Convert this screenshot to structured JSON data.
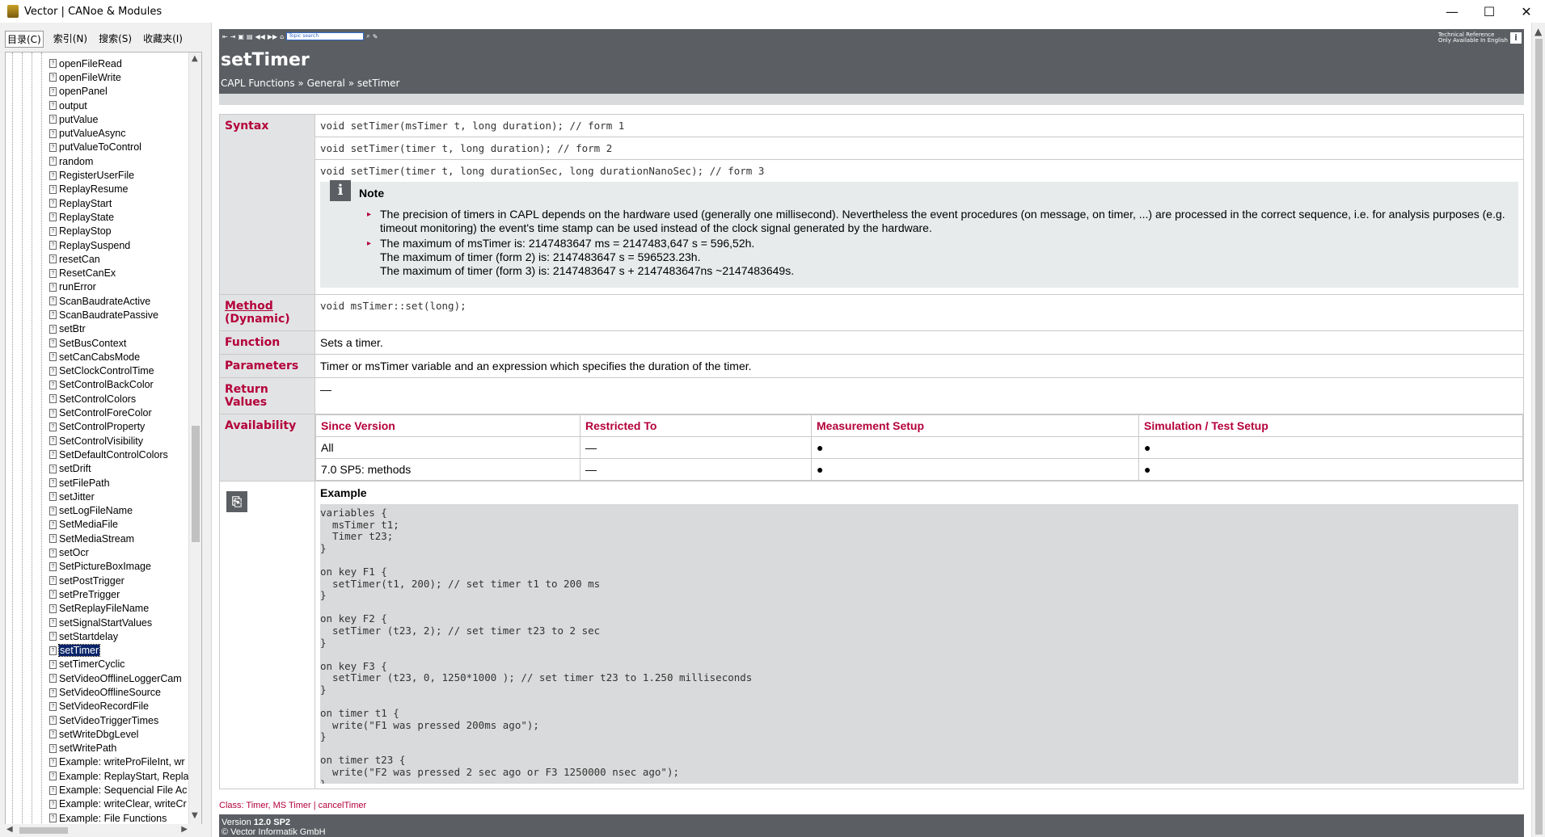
{
  "window": {
    "title": "Vector | CANoe & Modules",
    "minimize": "—",
    "maximize": "☐",
    "close": "✕"
  },
  "left_tabs": [
    "目录(C)",
    "索引(N)",
    "搜索(S)",
    "收藏夹(I)"
  ],
  "tree": {
    "items": [
      "openFileRead",
      "openFileWrite",
      "openPanel",
      "output",
      "putValue",
      "putValueAsync",
      "putValueToControl",
      "random",
      "RegisterUserFile",
      "ReplayResume",
      "ReplayStart",
      "ReplayState",
      "ReplayStop",
      "ReplaySuspend",
      "resetCan",
      "ResetCanEx",
      "runError",
      "ScanBaudrateActive",
      "ScanBaudratePassive",
      "setBtr",
      "SetBusContext",
      "setCanCabsMode",
      "SetClockControlTime",
      "SetControlBackColor",
      "SetControlColors",
      "SetControlForeColor",
      "SetControlProperty",
      "SetControlVisibility",
      "SetDefaultControlColors",
      "setDrift",
      "setFilePath",
      "setJitter",
      "setLogFileName",
      "SetMediaFile",
      "SetMediaStream",
      "setOcr",
      "SetPictureBoxImage",
      "setPostTrigger",
      "setPreTrigger",
      "SetReplayFileName",
      "setSignalStartValues",
      "setStartdelay",
      "setTimer",
      "setTimerCyclic",
      "SetVideoOfflineLoggerCam",
      "SetVideoOfflineSource",
      "SetVideoRecordFile",
      "SetVideoTriggerTimes",
      "setWriteDbgLevel",
      "setWritePath",
      "Example: writeProFileInt, wr",
      "Example: ReplayStart, Repla",
      "Example: Sequencial File Ac",
      "Example: writeClear, writeCr",
      "Example: File Functions"
    ],
    "selected": "setTimer"
  },
  "toolbar": {
    "search_placeholder": "Topic search",
    "tech_ref_line1": "Technical Reference",
    "tech_ref_line2": "Only Available In English",
    "info": "i"
  },
  "topic": {
    "title": "setTimer",
    "breadcrumb": "CAPL Functions » General » setTimer"
  },
  "syntax": {
    "label": "Syntax",
    "form1": "void setTimer(msTimer t, long duration); // form 1",
    "form2": "void setTimer(timer t, long duration); // form 2",
    "form3": "void setTimer(timer t, long durationSec, long durationNanoSec); // form 3"
  },
  "note": {
    "icon": "i",
    "title": "Note",
    "item1": "The precision of timers in CAPL depends on the hardware used (generally one millisecond). Nevertheless the event procedures (on message, on timer, ...) are processed in the correct sequence, i.e. for analysis purposes (e.g. timeout monitoring) the event's time stamp can be used instead of the clock signal generated by the hardware.",
    "item2_l1": "The maximum of msTimer is: 2147483647 ms = 2147483,647 s = 596,52h.",
    "item2_l2": "The maximum of timer (form 2) is: 2147483647 s = 596523.23h.",
    "item2_l3": "The maximum of timer (form 3) is: 2147483647 s + 2147483647ns ~2147483649s."
  },
  "method": {
    "label1": "Method",
    "label2": "(Dynamic)",
    "code": "void msTimer::set(long);"
  },
  "function": {
    "label": "Function",
    "value": "Sets a timer."
  },
  "parameters": {
    "label": "Parameters",
    "value": "Timer or msTimer variable and an expression which specifies the duration of the timer."
  },
  "return_values": {
    "label": "Return Values",
    "value": "—"
  },
  "availability": {
    "label": "Availability",
    "headers": [
      "Since Version",
      "Restricted To",
      "Measurement Setup",
      "Simulation / Test Setup"
    ],
    "rows": [
      [
        "All",
        "—",
        "●",
        "●"
      ],
      [
        "7.0 SP5: methods",
        "—",
        "●",
        "●"
      ]
    ]
  },
  "example": {
    "title": "Example",
    "code": "variables {\n  msTimer t1;\n  Timer t23;\n}\n\non key F1 {\n  setTimer(t1, 200); // set timer t1 to 200 ms\n}\n\non key F2 {\n  setTimer (t23, 2); // set timer t23 to 2 sec\n}\n\non key F3 {\n  setTimer (t23, 0, 1250*1000 ); // set timer t23 to 1.250 milliseconds\n}\n\non timer t1 {\n  write(\"F1 was pressed 200ms ago\");\n}\n\non timer t23 {\n  write(\"F2 was pressed 2 sec ago or F3 1250000 nsec ago\");\n}"
  },
  "footer": {
    "class_links": "Class: Timer, MS Timer | cancelTimer",
    "version_label": "Version",
    "version_value": "12.0 SP2",
    "copyright": "© Vector Informatik GmbH"
  },
  "colors": {
    "accent": "#b4003a",
    "header_bg": "#5b5f63",
    "label_bg": "#e2e3e4"
  }
}
